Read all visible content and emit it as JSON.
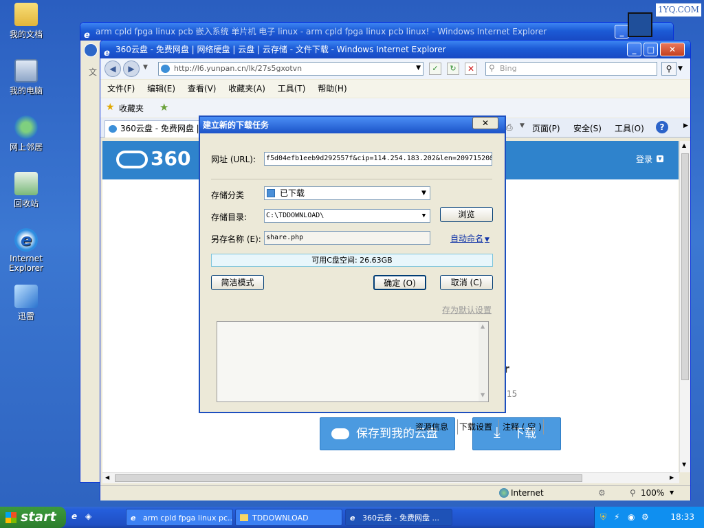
{
  "watermark": "1YQ.COM",
  "desktop_icons": [
    {
      "label": "我的文档",
      "icon": "folder-icon"
    },
    {
      "label": "我的电脑",
      "icon": "computer-icon"
    },
    {
      "label": "网上邻居",
      "icon": "network-icon"
    },
    {
      "label": "回收站",
      "icon": "recycle-bin-icon"
    },
    {
      "label": "Internet Explorer",
      "icon": "ie-icon"
    },
    {
      "label": "迅雷",
      "icon": "thunder-icon"
    }
  ],
  "back_window": {
    "title": "arm cpld fpga linux pcb 嵌入系统 单片机 电子 linux - arm cpld fpga linux pcb linux! - Windows Internet Explorer",
    "address_fragment": "文"
  },
  "ie": {
    "title": "360云盘 - 免费网盘 | 网络硬盘 | 云盘 | 云存储 - 文件下载 - Windows Internet Explorer",
    "address": "http://l6.yunpan.cn/lk/27s5gxotvn",
    "search_placeholder": "Bing",
    "menu": [
      "文件(F)",
      "编辑(E)",
      "查看(V)",
      "收藏夹(A)",
      "工具(T)",
      "帮助(H)"
    ],
    "favorites_label": "收藏夹",
    "tab_label": "360云盘 - 免费网盘 | 网",
    "cmd": {
      "page": "页面(P)",
      "safety": "安全(S)",
      "tools": "工具(O)"
    },
    "status_zone": "Internet",
    "zoom": "100%"
  },
  "site": {
    "logo": "360",
    "login": "登录",
    "file_suffix": "r",
    "file_date_suffix": "15",
    "save_button": "保存到我的云盘",
    "download_button": "下载",
    "accent": "#2f83cc",
    "button_color": "#4b9ae0"
  },
  "dialog": {
    "title": "建立新的下载任务",
    "url_label": "网址 (URL):",
    "url_value": "f5d04efb1eeb9d292557f&cip=114.254.183.202&len=20971520&",
    "category_label": "存储分类",
    "category_value": "已下载",
    "dir_label": "存储目录:",
    "dir_value": "C:\\TDDOWNLOAD\\",
    "browse_button": "浏览",
    "saveas_label": "另存名称 (E):",
    "saveas_value": "share.php",
    "auto_name": "自动命名",
    "free_space": "可用C盘空间: 26.63GB",
    "simple_mode_button": "简洁模式",
    "ok_button": "确定 (O)",
    "cancel_button": "取消 (C)",
    "tabs": [
      "资源信息",
      "下载设置",
      "注释 ( 空 )"
    ],
    "save_default": "存为默认设置"
  },
  "taskbar": {
    "start": "start",
    "tasks": [
      {
        "label": "arm cpld fpga linux pc...",
        "active": false
      },
      {
        "label": "TDDOWNLOAD",
        "active": false
      },
      {
        "label": "360云盘 - 免费网盘 ...",
        "active": true
      }
    ],
    "clock": "18:33"
  }
}
